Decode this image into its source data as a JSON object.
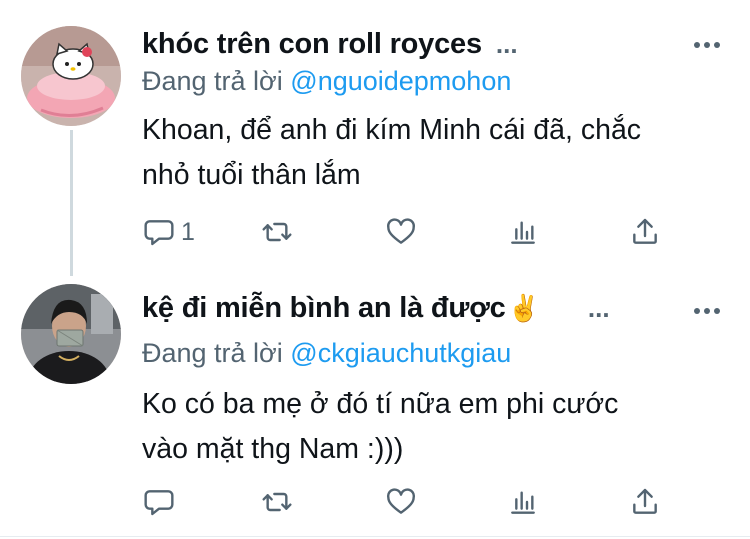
{
  "tweets": [
    {
      "author": {
        "display_name": "khóc trên con roll royces",
        "truncation": "..."
      },
      "reply_prefix": "Đang trả lời",
      "reply_to": "@nguoidepmohon",
      "text_lines": [
        "Khoan, để anh đi kím Minh cái đã, chắc",
        "nhỏ tuổi thân lắm"
      ],
      "stats": {
        "replies": "1",
        "retweets": "",
        "likes": ""
      },
      "avatar_icon": "hello-kitty-avatar"
    },
    {
      "author": {
        "display_name": "kệ đi miễn bình an là được",
        "emoji": "✌️",
        "truncation": "..."
      },
      "reply_prefix": "Đang trả lời",
      "reply_to": "@ckgiauchutkgiau",
      "text_lines": [
        "Ko có ba mẹ ở đó tí nữa em phi cước",
        "vào mặt thg Nam :)))"
      ],
      "stats": {
        "replies": "",
        "retweets": "",
        "likes": ""
      },
      "avatar_icon": "person-avatar"
    }
  ],
  "icons": {
    "reply": "speech-bubble-icon",
    "retweet": "retweet-icon",
    "like": "heart-icon",
    "stats": "bar-chart-icon",
    "share": "share-upload-icon",
    "more": "more-dots-icon"
  },
  "colors": {
    "text": "#0f1419",
    "secondary": "#536471",
    "link": "#1d9bf0",
    "divider": "#e6ecf0",
    "thread_line": "#cfd9de"
  }
}
